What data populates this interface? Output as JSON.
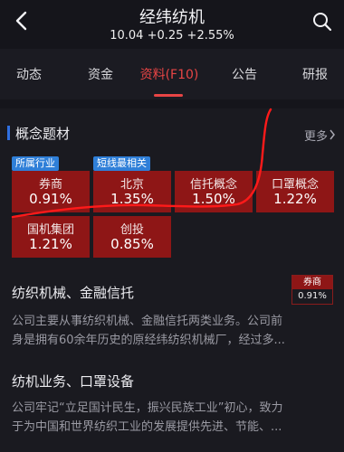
{
  "header": {
    "stock_name": "经纬纺机",
    "quote": "10.04 +0.25 +2.55%"
  },
  "tabs": [
    {
      "label": "动态"
    },
    {
      "label": "资金"
    },
    {
      "label": "资料(F10)",
      "active": true
    },
    {
      "label": "公告"
    },
    {
      "label": "研报"
    }
  ],
  "concepts": {
    "title": "概念题材",
    "more": "更多",
    "tiles": [
      {
        "name": "券商",
        "pct": "0.91%",
        "tag": "所属行业"
      },
      {
        "name": "北京",
        "pct": "1.35%",
        "tag": "短线最相关"
      },
      {
        "name": "信托概念",
        "pct": "1.50%"
      },
      {
        "name": "口罩概念",
        "pct": "1.22%"
      },
      {
        "name": "国机集团",
        "pct": "1.21%"
      },
      {
        "name": "创投",
        "pct": "0.85%"
      }
    ]
  },
  "news": [
    {
      "title": "纺织机械、金融信托",
      "body_line1": "公司主要从事纺织机械、金融信托两类业务。公司前",
      "body_line2": "身是拥有60余年历史的原经纬纺织机械厂，经过多...",
      "badge": {
        "name": "券商",
        "pct": "0.91%"
      }
    },
    {
      "title": "纺机业务、口罩设备",
      "body_line1": "公司牢记“立足国计民生，振兴民族工业”初心，致力",
      "body_line2": "于为中国和世界纺织工业的发展提供先进、节能、..."
    }
  ],
  "colors": {
    "accent_red": "#e84545",
    "tile_red": "#8e1616",
    "tag_blue": "#2f7fd8",
    "annotation_red": "#ff1a1a"
  },
  "icons": [
    "back-arrow-icon",
    "search-icon",
    "chevron-right-icon"
  ]
}
